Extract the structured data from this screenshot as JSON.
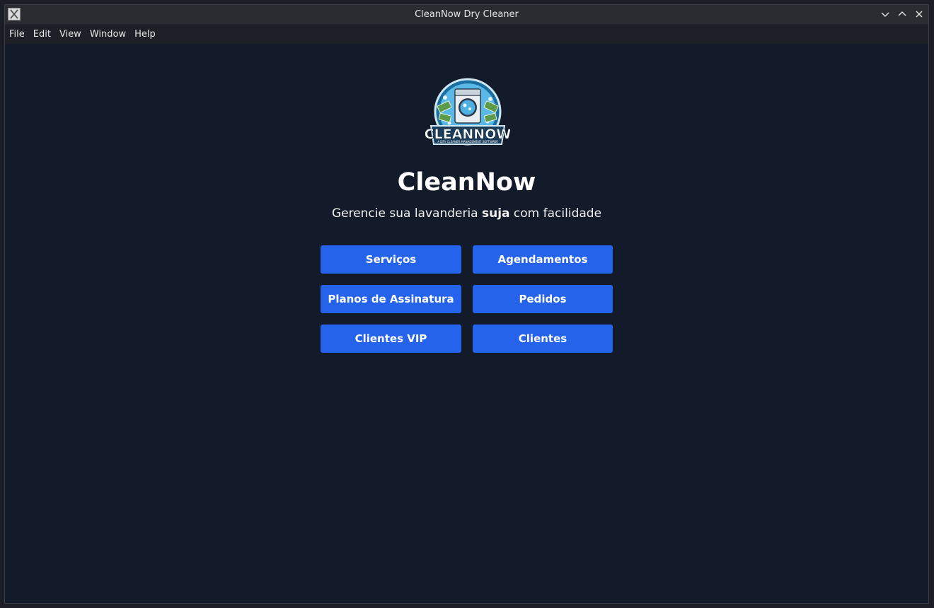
{
  "window": {
    "title": "CleanNow Dry Cleaner",
    "controls": [
      "minimize-icon",
      "maximize-icon",
      "close-icon"
    ]
  },
  "menubar": {
    "items": [
      "File",
      "Edit",
      "View",
      "Window",
      "Help"
    ]
  },
  "logo": {
    "wordmark": "CLEANNOW",
    "tagline": "A DRY CLEANER MANAGEMENT SOFTWARE"
  },
  "hero": {
    "name": "CleanNow",
    "tagline_before": "Gerencie sua lavanderia ",
    "tagline_bold": "suja",
    "tagline_after": " com facilidade"
  },
  "buttons": {
    "servicos": "Serviços",
    "agendamentos": "Agendamentos",
    "planos": "Planos de Assinatura",
    "pedidos": "Pedidos",
    "clientes_vip": "Clientes VIP",
    "clientes": "Clientes"
  },
  "colors": {
    "background": "#131a29",
    "button": "#2563eb",
    "titlebar": "#2a2c31"
  }
}
